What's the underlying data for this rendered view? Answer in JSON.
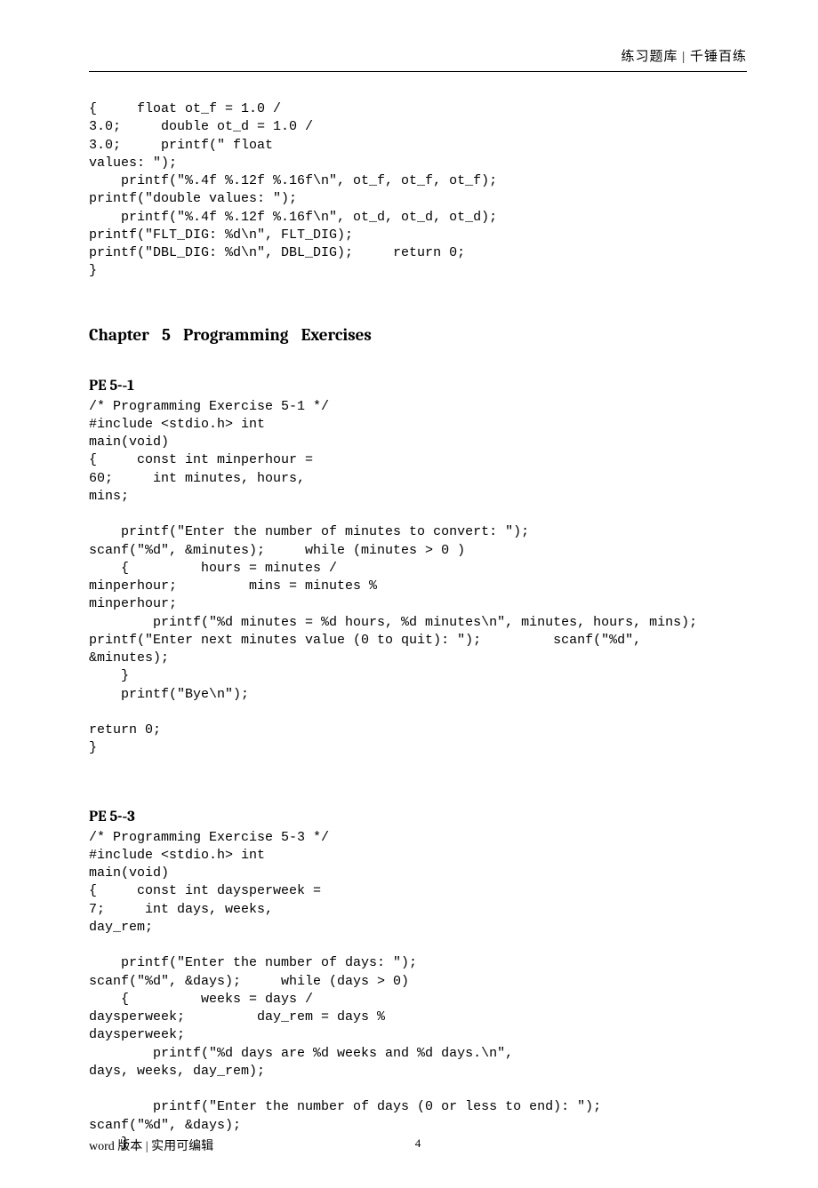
{
  "header": {
    "right": "练习题库  |  千锤百练"
  },
  "code_top": "{     float ot_f = 1.0 /\n3.0;     double ot_d = 1.0 /\n3.0;     printf(\" float\nvalues: \");\n    printf(\"%.4f %.12f %.16f\\n\", ot_f, ot_f, ot_f);\nprintf(\"double values: \");\n    printf(\"%.4f %.12f %.16f\\n\", ot_d, ot_d, ot_d);\nprintf(\"FLT_DIG: %d\\n\", FLT_DIG);\nprintf(\"DBL_DIG: %d\\n\", DBL_DIG);     return 0;\n}",
  "chapter": "Chapter  5   Programming   Exercises",
  "pe1": {
    "title": "PE   5-­‐1",
    "code": "/* Programming Exercise 5-1 */\n#include <stdio.h> int\nmain(void)\n{     const int minperhour =\n60;     int minutes, hours,\nmins;\n\n    printf(\"Enter the number of minutes to convert: \");\nscanf(\"%d\", &minutes);     while (minutes > 0 )\n    {         hours = minutes /\nminperhour;         mins = minutes %\nminperhour;\n        printf(\"%d minutes = %d hours, %d minutes\\n\", minutes, hours, mins);\nprintf(\"Enter next minutes value (0 to quit): \");         scanf(\"%d\",\n&minutes);\n    }\n    printf(\"Bye\\n\");\n\nreturn 0;\n}"
  },
  "pe3": {
    "title": "PE   5-­‐3",
    "code": "/* Programming Exercise 5-3 */\n#include <stdio.h> int\nmain(void)\n{     const int daysperweek =\n7;     int days, weeks,\nday_rem;\n\n    printf(\"Enter the number of days: \");\nscanf(\"%d\", &days);     while (days > 0)\n    {         weeks = days /\ndaysperweek;         day_rem = days %\ndaysperweek;\n        printf(\"%d days are %d weeks and %d days.\\n\",\ndays, weeks, day_rem);\n\n        printf(\"Enter the number of days (0 or less to end): \");\nscanf(\"%d\", &days);\n    }"
  },
  "footer": {
    "left": "word 版本  |  实用可编辑",
    "page": "4"
  }
}
